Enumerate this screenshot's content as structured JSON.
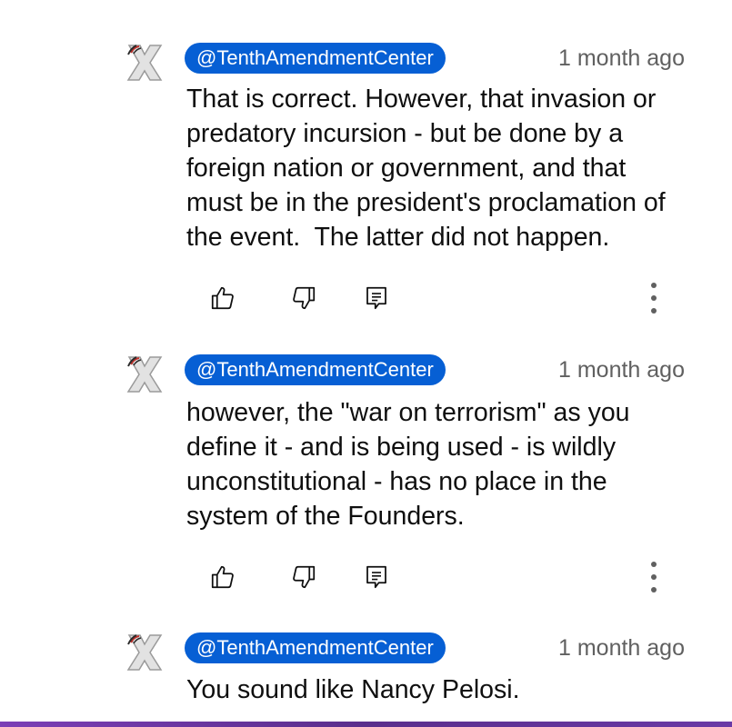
{
  "comments": [
    {
      "handle": "@TenthAmendmentCenter",
      "time": "1 month ago",
      "text": "That is correct. However, that invasion or\npredatory incursion - but be done by a\nforeign nation or government, and that\nmust be in the president's proclamation of\nthe event.  The latter did not happen.",
      "has_actions": true
    },
    {
      "handle": "@TenthAmendmentCenter",
      "time": "1 month ago",
      "text": "however, the \"war on terrorism\" as you\ndefine it - and is being used - is wildly\nunconstitutional - has no place in the\nsystem of the Founders.",
      "has_actions": true
    },
    {
      "handle": "@TenthAmendmentCenter",
      "time": "1 month ago",
      "text": "You sound like Nancy Pelosi.",
      "has_actions": false
    }
  ],
  "icons": {
    "avatar": "tenth-amendment-x-logo",
    "like": "thumbs-up-icon",
    "dislike": "thumbs-down-icon",
    "reply": "reply-comment-icon",
    "more": "more-vertical-icon"
  },
  "colors": {
    "handle_chip": "#065fd4",
    "timestamp": "#606060",
    "text": "#0f0f0f",
    "bottom_bar": "#6a3aa6"
  }
}
